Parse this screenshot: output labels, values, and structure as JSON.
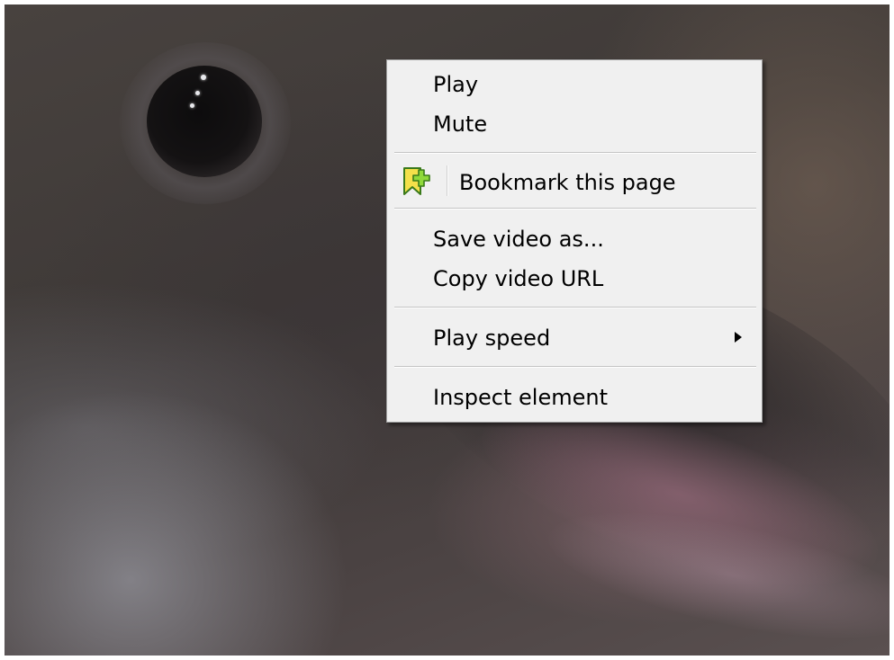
{
  "context_menu": {
    "items": {
      "play": {
        "label": "Play"
      },
      "mute": {
        "label": "Mute"
      },
      "bookmark": {
        "label": "Bookmark this page",
        "icon": "bookmark-add-icon"
      },
      "save_video": {
        "label": "Save video as..."
      },
      "copy_url": {
        "label": "Copy video URL"
      },
      "play_speed": {
        "label": "Play speed",
        "icon": "submenu-arrow-icon"
      },
      "inspect": {
        "label": "Inspect element"
      }
    }
  },
  "colors": {
    "menu_background": "#f0f0f0",
    "menu_border": "#a0a0a0",
    "bookmark_icon_fill": "#8fd93a",
    "bookmark_icon_border": "#3a7a1a"
  }
}
